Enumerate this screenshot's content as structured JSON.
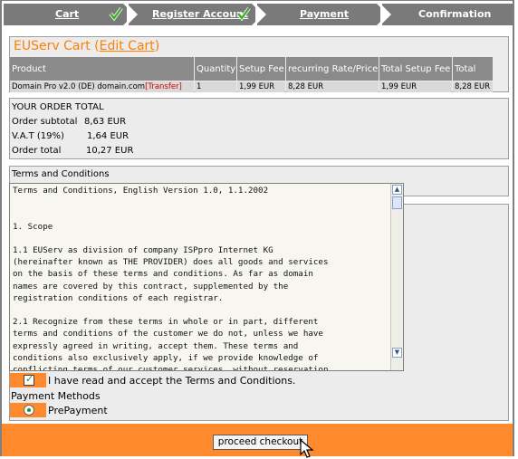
{
  "steps": [
    {
      "label": "Cart",
      "done": true
    },
    {
      "label": "Register Account",
      "done": true
    },
    {
      "label": "Payment",
      "done": false
    },
    {
      "label": "Confirmation",
      "done": false
    }
  ],
  "cart": {
    "title_prefix": "EUServ Cart (",
    "edit_link": "Edit Cart",
    "title_suffix": ")",
    "columns": [
      "Product",
      "Quantity",
      "Setup Fee",
      "recurring Rate/Price",
      "Total Setup Fee",
      "Total"
    ],
    "row": {
      "product": "Domain Pro v2.0 (DE) domain.com",
      "transfer": "[Transfer]",
      "quantity": "1",
      "setup_fee": "1,99 EUR",
      "recurring": "8,28 EUR",
      "total_setup": "1,99 EUR",
      "total": "8,28 EUR"
    }
  },
  "order_total": {
    "heading": "YOUR ORDER TOTAL",
    "subtotal_label": "Order subtotal",
    "subtotal_value": "8,63 EUR",
    "vat_label": "V.A.T (19%)",
    "vat_value": "1,64 EUR",
    "total_label": "Order total",
    "total_value": "10,27 EUR"
  },
  "terms": {
    "heading": "Terms and Conditions",
    "text": "Terms and Conditions, English Version 1.0, 1.1.2002\n\n\n1. Scope\n\n1.1 EUServ as division of company ISPpro Internet KG\n(hereinafter known as THE PROVIDER) does all goods and services\non the basis of these terms and conditions. As far as domain\nnames are covered by this contract, supplemented by the\nregistration conditions of each registrar.\n\n2.1 Recognize from these terms in whole or in part, different\nterms and conditions of the customer we do not, unless we have\nexpressly agreed in writing, accept them. These terms and\nconditions also exclusively apply, if we provide knowledge of\nconflicting terms of our customer services, without reservation.",
    "accept_label": "I have read and accept the Terms and Conditions."
  },
  "payment": {
    "heading": "Payment Methods",
    "option": "PrePayment"
  },
  "checkout": {
    "button_label": "proceed checkout"
  },
  "colors": {
    "accent": "#ff8a2e",
    "step_bg": "#7a7a7a",
    "check": "#2a8a2a"
  }
}
